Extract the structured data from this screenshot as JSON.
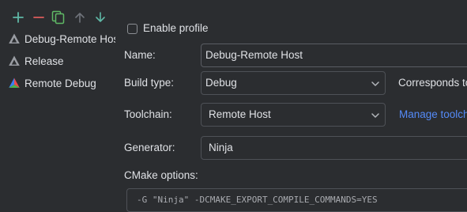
{
  "toolbar": {
    "add_icon": "plus-icon",
    "remove_icon": "minus-icon",
    "copy_icon": "copy-icon",
    "move_up_icon": "arrow-up-icon",
    "move_down_icon": "arrow-down-icon",
    "colors": {
      "add": "#5fb8a6",
      "remove": "#db5c5c",
      "copy": "#5fb865",
      "arrows_up": "#6f737a",
      "arrows_down": "#5fb8a6"
    }
  },
  "profiles": [
    {
      "label": "Debug-Remote Host",
      "icon": "cmake-triangle-icon",
      "selected": false
    },
    {
      "label": "Release",
      "icon": "cmake-triangle-icon"
    },
    {
      "label": "Remote Debug",
      "icon": "cmake-colored-triangle-icon"
    }
  ],
  "form": {
    "enable_profile": {
      "label": "Enable profile",
      "checked": false
    },
    "name": {
      "label": "Name:",
      "value": "Debug-Remote Host"
    },
    "build_type": {
      "label": "Build type:",
      "value": "Debug",
      "note": "Corresponds to"
    },
    "toolchain": {
      "label": "Toolchain:",
      "value": "Remote Host",
      "link": "Manage toolch"
    },
    "generator": {
      "label": "Generator:",
      "value": "Ninja"
    },
    "cmake_options": {
      "label": "CMake options:",
      "value": "-G \"Ninja\" -DCMAKE_EXPORT_COMPILE_COMMANDS=YES"
    }
  },
  "theme": {
    "background": "#2b2d30",
    "text": "#dfe1e5",
    "border": "#4e5157",
    "link": "#548af7"
  }
}
